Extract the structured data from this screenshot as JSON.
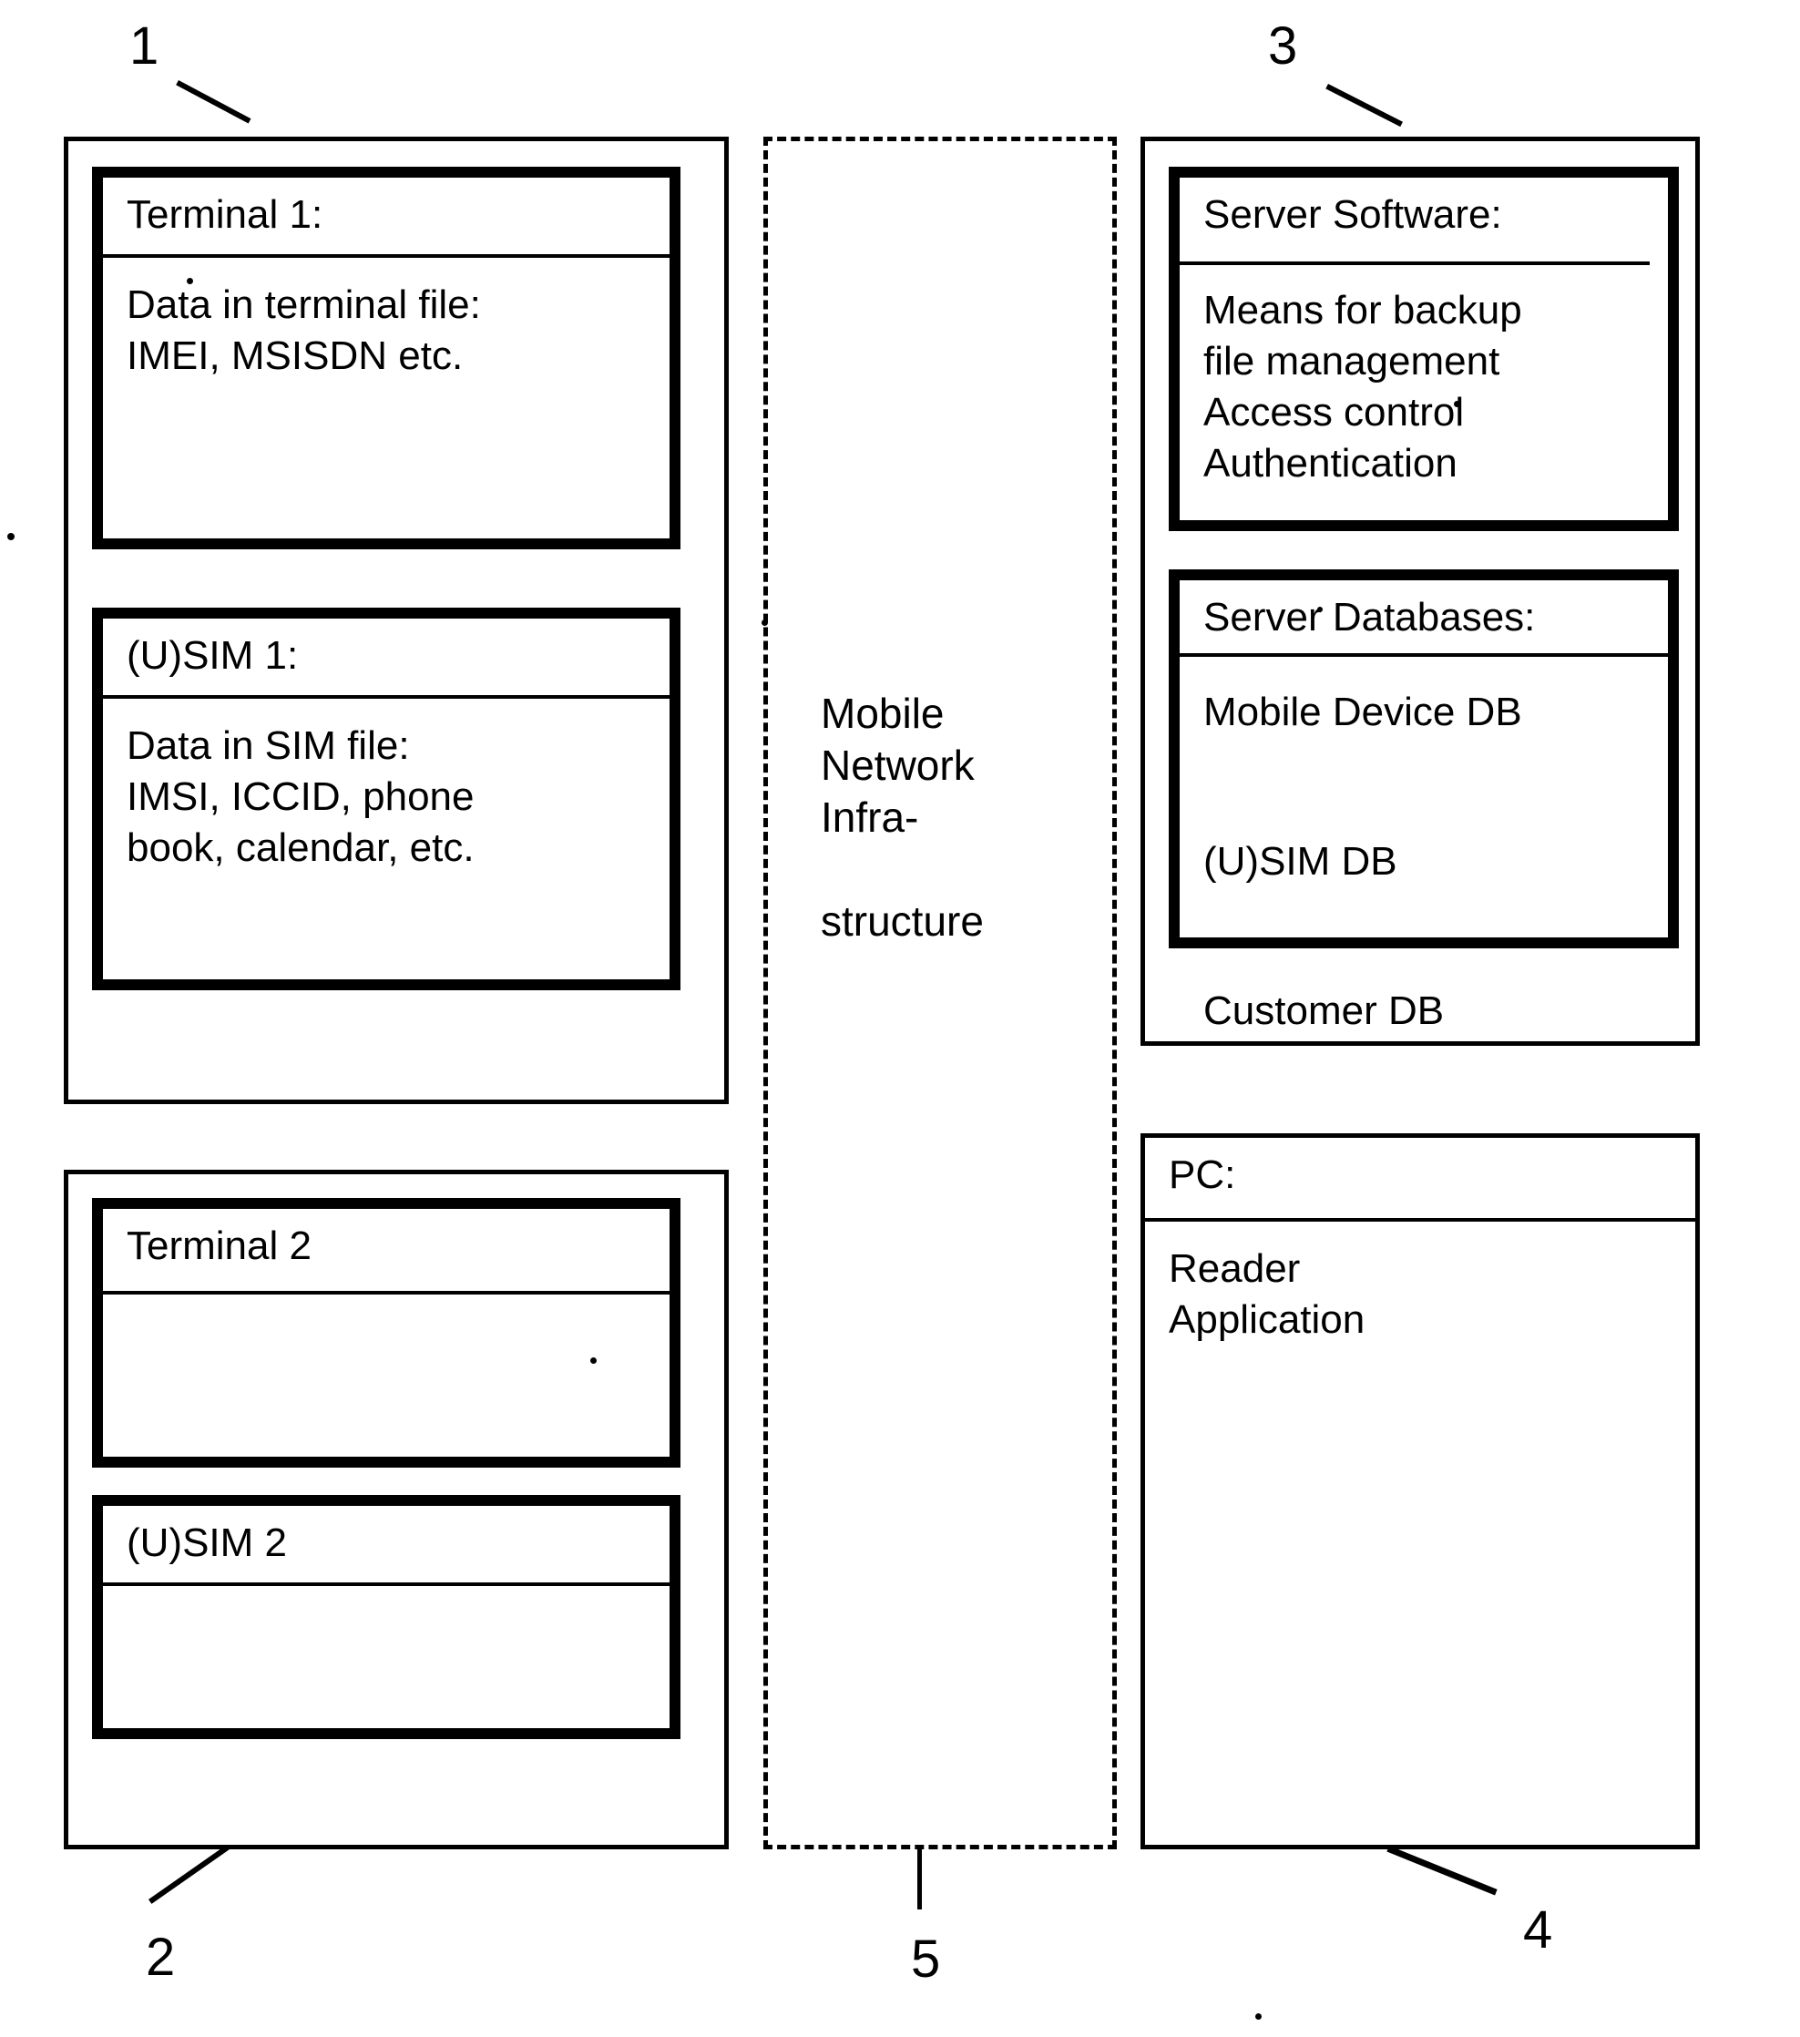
{
  "figure": {
    "title": "Mobile device backup system block diagram",
    "background_color": "#ffffff",
    "line_color": "#000000"
  },
  "reference_numerals": [
    {
      "id": "ref-1",
      "label": "1"
    },
    {
      "id": "ref-2",
      "label": "2"
    },
    {
      "id": "ref-3",
      "label": "3"
    },
    {
      "id": "ref-4",
      "label": "4"
    },
    {
      "id": "ref-5",
      "label": "5"
    }
  ],
  "left_column": {
    "device_1": {
      "ref": "1",
      "terminal": {
        "title": "Terminal 1:",
        "body": "Data in terminal file:\nIMEI, MSISDN etc."
      },
      "sim": {
        "title": "(U)SIM 1:",
        "body": "Data in SIM file:\nIMSI, ICCID, phone\nbook, calendar, etc."
      }
    },
    "device_2": {
      "ref": "2",
      "terminal": {
        "title": "Terminal 2",
        "body": ""
      },
      "sim": {
        "title": "(U)SIM 2",
        "body": ""
      }
    }
  },
  "middle_column": {
    "network": {
      "ref": "5",
      "label": "Mobile\nNetwork\nInfra-\n\nstructure"
    }
  },
  "right_column": {
    "server": {
      "ref": "3",
      "software": {
        "title": "Server Software:",
        "body": "Means for backup\nfile management\nAccess control\nAuthentication"
      },
      "databases": {
        "title": "Server Databases:",
        "body": "Mobile Device DB\n\n(U)SIM DB\n\nCustomer DB"
      }
    },
    "pc": {
      "ref": "4",
      "title": "PC:",
      "body": "Reader\nApplication"
    }
  }
}
